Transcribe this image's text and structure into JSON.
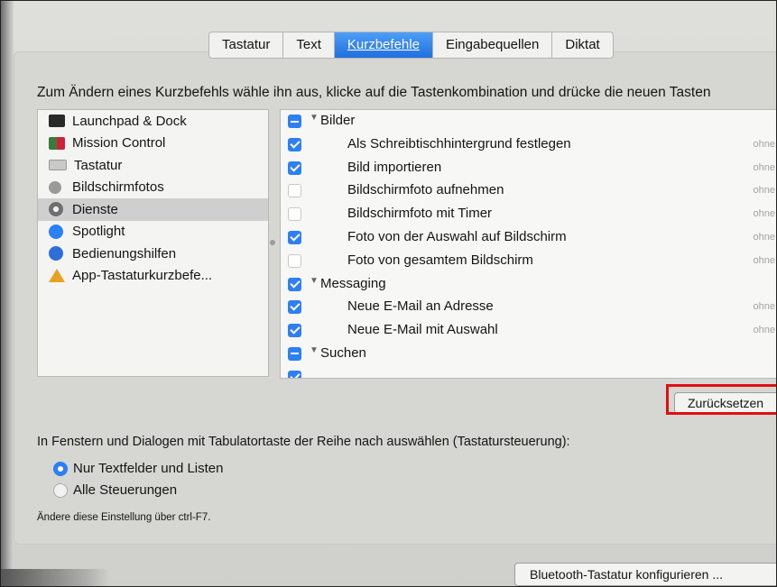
{
  "tabs": [
    {
      "label": "Tastatur"
    },
    {
      "label": "Text"
    },
    {
      "label": "Kurzbefehle"
    },
    {
      "label": "Eingabequellen"
    },
    {
      "label": "Diktat"
    }
  ],
  "instruction": "Zum Ändern eines Kurzbefehls wähle ihn aus, klicke auf die Tastenkombination und drücke die neuen Tasten",
  "categories": [
    {
      "label": "Launchpad & Dock",
      "icon": "launchpad-icon",
      "color": "#2a2a2a"
    },
    {
      "label": "Mission Control",
      "icon": "mission-control-icon",
      "color": "#3b7a3b"
    },
    {
      "label": "Tastatur",
      "icon": "keyboard-icon",
      "color": "#bdbdbd"
    },
    {
      "label": "Bildschirmfotos",
      "icon": "screenshot-icon",
      "color": "#8a8a8a"
    },
    {
      "label": "Dienste",
      "icon": "gear-icon",
      "color": "#6e6e6e"
    },
    {
      "label": "Spotlight",
      "icon": "spotlight-icon",
      "color": "#2d7ff4"
    },
    {
      "label": "Bedienungshilfen",
      "icon": "accessibility-icon",
      "color": "#2d6fd6"
    },
    {
      "label": "App-Tastaturkurzbefe...",
      "icon": "app-shortcuts-icon",
      "color": "#e8a020"
    }
  ],
  "shortcuts": {
    "group_bilder": "Bilder",
    "item_1": "Als Schreibtischhintergrund festlegen",
    "item_2": "Bild importieren",
    "item_3": "Bildschirmfoto aufnehmen",
    "item_4": "Bildschirmfoto mit Timer",
    "item_5": "Foto von der Auswahl auf Bildschirm",
    "item_6": "Foto von gesamtem Bildschirm",
    "group_messaging": "Messaging",
    "item_7": "Neue E-Mail an Adresse",
    "item_8": "Neue E-Mail mit Auswahl",
    "group_suchen": "Suchen",
    "none": "ohne"
  },
  "reset_button": "Zurücksetzen",
  "tab_nav_title": "In Fenstern und Dialogen mit Tabulatortaste der Reihe nach auswählen (Tastatursteuerung):",
  "radio_1": "Nur Textfelder und Listen",
  "radio_2": "Alle Steuerungen",
  "hint": "Ändere diese Einstellung über ctrl-F7.",
  "bluetooth_button": "Bluetooth-Tastatur konfigurieren ...",
  "colors": {
    "accent": "#2d7ff4",
    "highlight_box": "#e01010"
  }
}
